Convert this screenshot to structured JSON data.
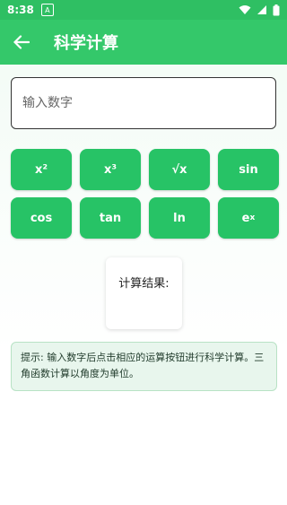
{
  "status_bar": {
    "time": "8:38",
    "a_label": "A"
  },
  "app_bar": {
    "title": "科学计算"
  },
  "input": {
    "placeholder": "输入数字",
    "value": ""
  },
  "buttons": [
    {
      "label": "x²"
    },
    {
      "label": "x³"
    },
    {
      "label": "√x"
    },
    {
      "label": "sin"
    },
    {
      "label": "cos"
    },
    {
      "label": "tan"
    },
    {
      "label": "ln"
    },
    {
      "label_base": "e",
      "label_sup": "x"
    }
  ],
  "result": {
    "label": "计算结果:"
  },
  "hint": {
    "text": "提示: 输入数字后点击相应的运算按钮进行科学计算。三角函数计算以角度为单位。"
  }
}
